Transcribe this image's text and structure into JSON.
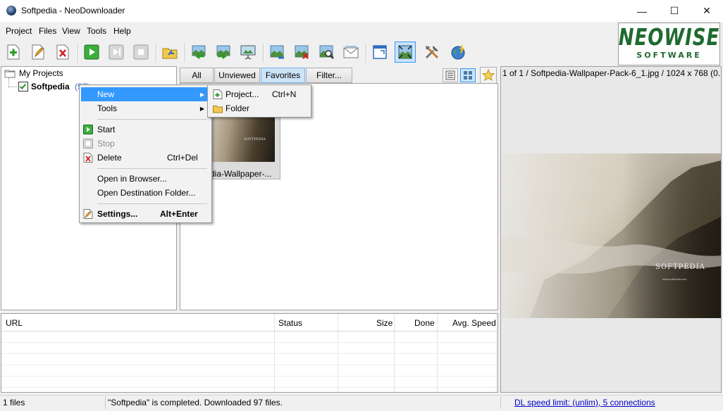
{
  "window": {
    "title": "Softpedia - NeoDownloader",
    "minimize": "—",
    "maximize": "☐",
    "close": "✕"
  },
  "menubar": [
    "Project",
    "Files",
    "View",
    "Tools",
    "Help"
  ],
  "logo": {
    "word": "NEOWISE",
    "sub": "SOFTWARE"
  },
  "toolbar": {
    "icons": [
      "new-project-icon",
      "edit-icon",
      "delete-icon",
      "start-icon",
      "resume-icon",
      "stop-icon",
      "open-folder-icon",
      "import-icon",
      "export-icon",
      "presentation-icon",
      "image-view-icon",
      "image-delete-icon",
      "image-search-icon",
      "email-icon",
      "window-icon",
      "fullscreen-icon",
      "tools-icon",
      "globe-icon"
    ]
  },
  "tree": {
    "root": "My Projects",
    "project": "Softpedia",
    "count": "(97)"
  },
  "filters": {
    "tabs": [
      "All",
      "Unviewed",
      "Favorites",
      "Filter..."
    ],
    "active": "Favorites"
  },
  "thumbnail": {
    "caption": "dia-Wallpaper-...",
    "watermark": "SOFTPEDIA"
  },
  "context_menu": {
    "items": {
      "new": "New",
      "tools": "Tools",
      "start": "Start",
      "stop": "Stop",
      "delete": "Delete",
      "delete_shortcut": "Ctrl+Del",
      "open_browser": "Open in Browser...",
      "open_folder": "Open Destination Folder...",
      "settings": "Settings...",
      "settings_shortcut": "Alt+Enter"
    }
  },
  "submenu": {
    "project": "Project...",
    "project_shortcut": "Ctrl+N",
    "folder": "Folder"
  },
  "list": {
    "columns": [
      "URL",
      "Status",
      "Size",
      "Done",
      "Avg. Speed"
    ]
  },
  "preview": {
    "header": "1 of 1 / Softpedia-Wallpaper-Pack-6_1.jpg / 1024 x 768 (0....",
    "watermark": "SOFTPEDIA",
    "watermark_url": "www.softpedia.com"
  },
  "status": {
    "files": "1 files",
    "message": "\"Softpedia\" is completed. Downloaded 97 files.",
    "speed_link": "DL speed limit: (unlim), 5 connections"
  },
  "colors": {
    "accent": "#3399ff",
    "logo_green": "#1f6a2f",
    "link": "#0000cc"
  }
}
